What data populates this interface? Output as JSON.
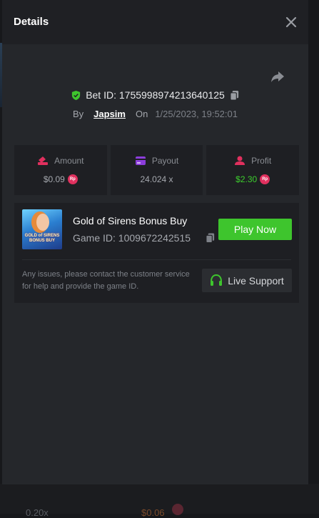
{
  "modal": {
    "title": "Details",
    "close_icon": "close-icon",
    "share_icon": "share-icon"
  },
  "bet": {
    "id_label": "Bet ID: 1755998974213640125",
    "by_label": "By",
    "username": "Japsim",
    "on_label": "On",
    "datetime": "1/25/2023, 19:52:01"
  },
  "stats": {
    "amount": {
      "label": "Amount",
      "value": "$0.09",
      "currency_badge": "Rp",
      "icon": "amount-icon",
      "icon_color": "#e0305e"
    },
    "payout": {
      "label": "Payout",
      "value": "24.024 x",
      "icon": "payout-icon",
      "icon_color": "#8c3ddb"
    },
    "profit": {
      "label": "Profit",
      "value": "$2.30",
      "currency_badge": "Rp",
      "icon": "profit-icon",
      "icon_color": "#e0305e",
      "value_color": "#3dce2e"
    }
  },
  "game": {
    "name": "Gold of Sirens Bonus Buy",
    "id_label": "Game ID: 1009672242515",
    "thumbnail_text": "GOLD of SIRENS BONUS BUY",
    "play_label": "Play Now",
    "help_text": "Any issues, please contact the customer service for help and provide the game ID.",
    "support_label": "Live Support"
  },
  "background": {
    "ghost_left": "0.20x",
    "ghost_right": "$0.06"
  },
  "colors": {
    "accent_green": "#3ec52d",
    "badge_red": "#e0305e"
  }
}
